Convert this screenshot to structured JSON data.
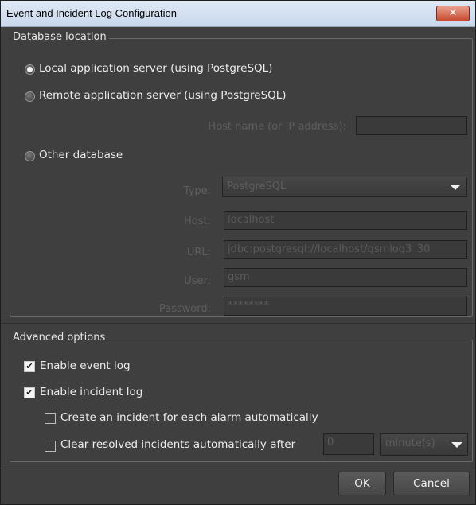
{
  "window": {
    "title": "Event and Incident Log Configuration",
    "close_glyph": "✕"
  },
  "database_location": {
    "legend": "Database location",
    "options": [
      {
        "label": "Local application server (using PostgreSQL)",
        "selected": true
      },
      {
        "label": "Remote application server (using PostgreSQL)",
        "selected": false
      },
      {
        "label": "Other database",
        "selected": false
      }
    ],
    "host_name_label": "Host name (or IP address):",
    "host_name_value": "",
    "type_label": "Type:",
    "type_value": "PostgreSQL",
    "host_label": "Host:",
    "host_value": "localhost",
    "url_label": "URL:",
    "url_value": "jdbc:postgresql://localhost/gsmlog3_30",
    "user_label": "User:",
    "user_value": "gsm",
    "password_label": "Password:",
    "password_value": "********"
  },
  "advanced": {
    "legend": "Advanced options",
    "enable_event_log": {
      "label": "Enable event log",
      "checked": true
    },
    "enable_incident_log": {
      "label": "Enable incident log",
      "checked": true
    },
    "create_incident": {
      "label": "Create an incident for each alarm automatically",
      "checked": false
    },
    "clear_resolved": {
      "label": "Clear resolved incidents automatically after",
      "checked": false
    },
    "clear_value": "0",
    "clear_unit": "minute(s)"
  },
  "buttons": {
    "ok": "OK",
    "cancel": "Cancel"
  }
}
